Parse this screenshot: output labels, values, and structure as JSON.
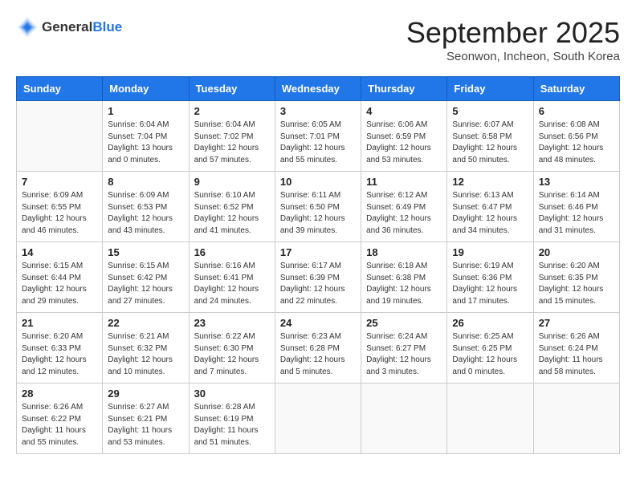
{
  "header": {
    "logo_general": "General",
    "logo_blue": "Blue",
    "month_title": "September 2025",
    "subtitle": "Seonwon, Incheon, South Korea"
  },
  "weekdays": [
    "Sunday",
    "Monday",
    "Tuesday",
    "Wednesday",
    "Thursday",
    "Friday",
    "Saturday"
  ],
  "weeks": [
    [
      {
        "day": "",
        "sunrise": "",
        "sunset": "",
        "daylight": ""
      },
      {
        "day": "1",
        "sunrise": "Sunrise: 6:04 AM",
        "sunset": "Sunset: 7:04 PM",
        "daylight": "Daylight: 13 hours and 0 minutes."
      },
      {
        "day": "2",
        "sunrise": "Sunrise: 6:04 AM",
        "sunset": "Sunset: 7:02 PM",
        "daylight": "Daylight: 12 hours and 57 minutes."
      },
      {
        "day": "3",
        "sunrise": "Sunrise: 6:05 AM",
        "sunset": "Sunset: 7:01 PM",
        "daylight": "Daylight: 12 hours and 55 minutes."
      },
      {
        "day": "4",
        "sunrise": "Sunrise: 6:06 AM",
        "sunset": "Sunset: 6:59 PM",
        "daylight": "Daylight: 12 hours and 53 minutes."
      },
      {
        "day": "5",
        "sunrise": "Sunrise: 6:07 AM",
        "sunset": "Sunset: 6:58 PM",
        "daylight": "Daylight: 12 hours and 50 minutes."
      },
      {
        "day": "6",
        "sunrise": "Sunrise: 6:08 AM",
        "sunset": "Sunset: 6:56 PM",
        "daylight": "Daylight: 12 hours and 48 minutes."
      }
    ],
    [
      {
        "day": "7",
        "sunrise": "Sunrise: 6:09 AM",
        "sunset": "Sunset: 6:55 PM",
        "daylight": "Daylight: 12 hours and 46 minutes."
      },
      {
        "day": "8",
        "sunrise": "Sunrise: 6:09 AM",
        "sunset": "Sunset: 6:53 PM",
        "daylight": "Daylight: 12 hours and 43 minutes."
      },
      {
        "day": "9",
        "sunrise": "Sunrise: 6:10 AM",
        "sunset": "Sunset: 6:52 PM",
        "daylight": "Daylight: 12 hours and 41 minutes."
      },
      {
        "day": "10",
        "sunrise": "Sunrise: 6:11 AM",
        "sunset": "Sunset: 6:50 PM",
        "daylight": "Daylight: 12 hours and 39 minutes."
      },
      {
        "day": "11",
        "sunrise": "Sunrise: 6:12 AM",
        "sunset": "Sunset: 6:49 PM",
        "daylight": "Daylight: 12 hours and 36 minutes."
      },
      {
        "day": "12",
        "sunrise": "Sunrise: 6:13 AM",
        "sunset": "Sunset: 6:47 PM",
        "daylight": "Daylight: 12 hours and 34 minutes."
      },
      {
        "day": "13",
        "sunrise": "Sunrise: 6:14 AM",
        "sunset": "Sunset: 6:46 PM",
        "daylight": "Daylight: 12 hours and 31 minutes."
      }
    ],
    [
      {
        "day": "14",
        "sunrise": "Sunrise: 6:15 AM",
        "sunset": "Sunset: 6:44 PM",
        "daylight": "Daylight: 12 hours and 29 minutes."
      },
      {
        "day": "15",
        "sunrise": "Sunrise: 6:15 AM",
        "sunset": "Sunset: 6:42 PM",
        "daylight": "Daylight: 12 hours and 27 minutes."
      },
      {
        "day": "16",
        "sunrise": "Sunrise: 6:16 AM",
        "sunset": "Sunset: 6:41 PM",
        "daylight": "Daylight: 12 hours and 24 minutes."
      },
      {
        "day": "17",
        "sunrise": "Sunrise: 6:17 AM",
        "sunset": "Sunset: 6:39 PM",
        "daylight": "Daylight: 12 hours and 22 minutes."
      },
      {
        "day": "18",
        "sunrise": "Sunrise: 6:18 AM",
        "sunset": "Sunset: 6:38 PM",
        "daylight": "Daylight: 12 hours and 19 minutes."
      },
      {
        "day": "19",
        "sunrise": "Sunrise: 6:19 AM",
        "sunset": "Sunset: 6:36 PM",
        "daylight": "Daylight: 12 hours and 17 minutes."
      },
      {
        "day": "20",
        "sunrise": "Sunrise: 6:20 AM",
        "sunset": "Sunset: 6:35 PM",
        "daylight": "Daylight: 12 hours and 15 minutes."
      }
    ],
    [
      {
        "day": "21",
        "sunrise": "Sunrise: 6:20 AM",
        "sunset": "Sunset: 6:33 PM",
        "daylight": "Daylight: 12 hours and 12 minutes."
      },
      {
        "day": "22",
        "sunrise": "Sunrise: 6:21 AM",
        "sunset": "Sunset: 6:32 PM",
        "daylight": "Daylight: 12 hours and 10 minutes."
      },
      {
        "day": "23",
        "sunrise": "Sunrise: 6:22 AM",
        "sunset": "Sunset: 6:30 PM",
        "daylight": "Daylight: 12 hours and 7 minutes."
      },
      {
        "day": "24",
        "sunrise": "Sunrise: 6:23 AM",
        "sunset": "Sunset: 6:28 PM",
        "daylight": "Daylight: 12 hours and 5 minutes."
      },
      {
        "day": "25",
        "sunrise": "Sunrise: 6:24 AM",
        "sunset": "Sunset: 6:27 PM",
        "daylight": "Daylight: 12 hours and 3 minutes."
      },
      {
        "day": "26",
        "sunrise": "Sunrise: 6:25 AM",
        "sunset": "Sunset: 6:25 PM",
        "daylight": "Daylight: 12 hours and 0 minutes."
      },
      {
        "day": "27",
        "sunrise": "Sunrise: 6:26 AM",
        "sunset": "Sunset: 6:24 PM",
        "daylight": "Daylight: 11 hours and 58 minutes."
      }
    ],
    [
      {
        "day": "28",
        "sunrise": "Sunrise: 6:26 AM",
        "sunset": "Sunset: 6:22 PM",
        "daylight": "Daylight: 11 hours and 55 minutes."
      },
      {
        "day": "29",
        "sunrise": "Sunrise: 6:27 AM",
        "sunset": "Sunset: 6:21 PM",
        "daylight": "Daylight: 11 hours and 53 minutes."
      },
      {
        "day": "30",
        "sunrise": "Sunrise: 6:28 AM",
        "sunset": "Sunset: 6:19 PM",
        "daylight": "Daylight: 11 hours and 51 minutes."
      },
      {
        "day": "",
        "sunrise": "",
        "sunset": "",
        "daylight": ""
      },
      {
        "day": "",
        "sunrise": "",
        "sunset": "",
        "daylight": ""
      },
      {
        "day": "",
        "sunrise": "",
        "sunset": "",
        "daylight": ""
      },
      {
        "day": "",
        "sunrise": "",
        "sunset": "",
        "daylight": ""
      }
    ]
  ]
}
